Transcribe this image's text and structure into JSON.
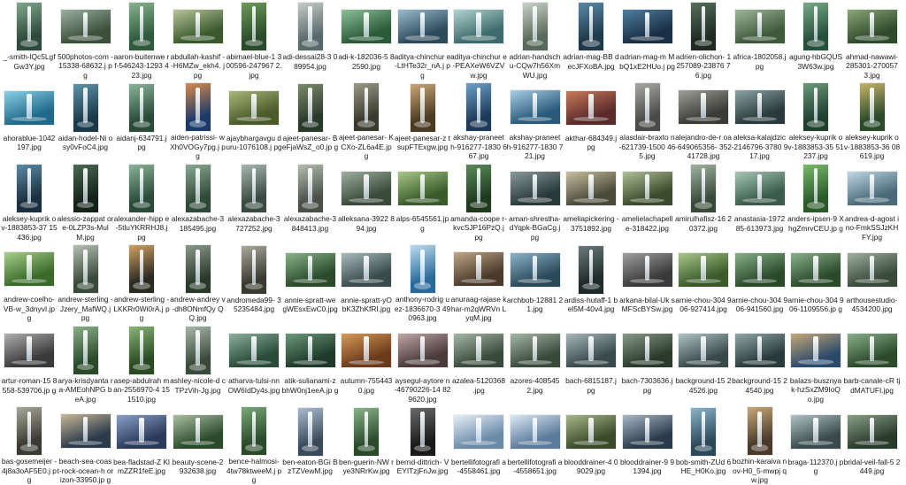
{
  "files": [
    {
      "name": "_-smith-lQc5Lgf Gw3Y.jpg",
      "thumb": "portrait",
      "c": [
        "#2d4a3a",
        "#7fa88c"
      ]
    },
    {
      "name": "500photos-com -15338-68632.j pg",
      "thumb": "landscape",
      "c": [
        "#3b4f3a",
        "#9bb0a0"
      ]
    },
    {
      "name": "aaron-buitenwe rf-546243-1293 423.jpg",
      "thumb": "portrait",
      "c": [
        "#2f5a3c",
        "#88b48f"
      ]
    },
    {
      "name": "abdullah-kashif --H6MZw_ekh4. jpg",
      "thumb": "landscape",
      "c": [
        "#3a5a2c",
        "#b8c49a"
      ]
    },
    {
      "name": "abimael-blue-1 300596-247967 2.jpg",
      "thumb": "portrait",
      "c": [
        "#2b4c2a",
        "#6e9a5a"
      ]
    },
    {
      "name": "adi-dessai28-3 089954.jpg",
      "thumb": "portrait",
      "c": [
        "#5a6a6a",
        "#c4ccc8"
      ]
    },
    {
      "name": "adi-k-182036-5 82590.jpg",
      "thumb": "landscape",
      "c": [
        "#2a5a3a",
        "#8cc09a"
      ]
    },
    {
      "name": "aditya-chinchur e-LtHTe32r_nA.j pg",
      "thumb": "landscape",
      "c": [
        "#2c4a5a",
        "#9bbcd0"
      ]
    },
    {
      "name": "aditya-chinchur e-PEAXeW6VZV w.jpg",
      "thumb": "landscape",
      "c": [
        "#3d6a6a",
        "#b0d4d0"
      ]
    },
    {
      "name": "adrian-handsch u-CQw7h56Xm WU.jpg",
      "thumb": "portrait",
      "c": [
        "#5a6a5a",
        "#c9d2c8"
      ]
    },
    {
      "name": "adrian-mag-BB decJFXoBA.jpg",
      "thumb": "portrait",
      "c": [
        "#1f3a4a",
        "#5a8aa8"
      ]
    },
    {
      "name": "adrian-mag-m MbQ1xE2HUo.j pg",
      "thumb": "landscape",
      "c": [
        "#1a2f45",
        "#4f7fa0"
      ]
    },
    {
      "name": "adrien-olichon- 1257089-23876 76.jpg",
      "thumb": "portrait",
      "c": [
        "#1e2a22",
        "#55705c"
      ]
    },
    {
      "name": "africa-1802058.j pg",
      "thumb": "landscape",
      "c": [
        "#3e5a3a",
        "#9cb898"
      ]
    },
    {
      "name": "agung-hbGQUS 3W63w.jpg",
      "thumb": "portrait",
      "c": [
        "#25503a",
        "#7aaa88"
      ]
    },
    {
      "name": "ahmad-nawawi- 285301-270057 3.jpg",
      "thumb": "landscape",
      "c": [
        "#2e4a2a",
        "#8aa878"
      ]
    },
    {
      "name": "ahorablue-1042 197.jpg",
      "thumb": "landscape",
      "c": [
        "#1f6a8a",
        "#8ad0e8"
      ]
    },
    {
      "name": "aidan-hodel-Ni osy0vFoC4.jpg",
      "thumb": "portrait",
      "c": [
        "#1a3a4a",
        "#5f94a8"
      ]
    },
    {
      "name": "aidanj-634791.j pg",
      "thumb": "portrait",
      "c": [
        "#2a4a3a",
        "#8ab49a"
      ]
    },
    {
      "name": "aiden-patrissi- wXh0VOGy7pg.j pg",
      "thumb": "portrait",
      "c": [
        "#1a3a6a",
        "#d88a4a"
      ]
    },
    {
      "name": "ajaybhargavgu duru-1076108.j pg",
      "thumb": "landscape",
      "c": [
        "#4a5a2a",
        "#a8b878"
      ]
    },
    {
      "name": "ajeet-panesar- BeFjaWsZ_o0.jp g",
      "thumb": "portrait",
      "c": [
        "#2a3a2a",
        "#7a8a6a"
      ]
    },
    {
      "name": "ajeet-panesar- KCXo-ZL6a4E.jp g",
      "thumb": "portrait",
      "c": [
        "#3a3a2e",
        "#9a9a88"
      ]
    },
    {
      "name": "ajeet-panesar-z tsupFTExgw.jpg",
      "thumb": "portrait",
      "c": [
        "#4a3a22",
        "#c8a878"
      ]
    },
    {
      "name": "akshay-praneet h-916277-1830 667.jpg",
      "thumb": "portrait",
      "c": [
        "#1e3a5a",
        "#6aa0c8"
      ]
    },
    {
      "name": "akshay-praneet h-916277-1830 721.jpg",
      "thumb": "landscape",
      "c": [
        "#2a5a7a",
        "#a8d0e8"
      ]
    },
    {
      "name": "akthar-684349.j pg",
      "thumb": "landscape",
      "c": [
        "#5a2a2a",
        "#c87a5a"
      ]
    },
    {
      "name": "alasdair-braxto n-621739-1500 465.jpg",
      "thumb": "portrait",
      "c": [
        "#4a4a48",
        "#a8a8a4"
      ]
    },
    {
      "name": "alejandro-de-r oa-649065356- 35241728.jpg",
      "thumb": "landscape",
      "c": [
        "#3a3a36",
        "#a0a09a"
      ]
    },
    {
      "name": "aleksa-kalajdzic -2146796-3780 917.jpg",
      "thumb": "landscape",
      "c": [
        "#2a3a3a",
        "#8aa4a4"
      ]
    },
    {
      "name": "aleksey-kuprik ov-1883853-35 51237.jpg",
      "thumb": "portrait",
      "c": [
        "#1f3f2f",
        "#6a9a7a"
      ]
    },
    {
      "name": "aleksey-kuprik ov-1883853-36 08619.jpg",
      "thumb": "portrait",
      "c": [
        "#2a4a2a",
        "#c8b46a"
      ]
    },
    {
      "name": "aleksey-kuprik ov-1883853-37 15436.jpg",
      "thumb": "portrait",
      "c": [
        "#1a2f3f",
        "#5a8aa8"
      ]
    },
    {
      "name": "alessio-zappat ore-0LZP3s-Mul M.jpg",
      "thumb": "portrait",
      "c": [
        "#14221a",
        "#4a6a52"
      ]
    },
    {
      "name": "alexander-hipp e-5tluYKRRHJ8.j pg",
      "thumb": "portrait",
      "c": [
        "#2a4a3a",
        "#8ab49a"
      ]
    },
    {
      "name": "alexazabache-3 185495.jpg",
      "thumb": "portrait",
      "c": [
        "#2f4a36",
        "#8aa894"
      ]
    },
    {
      "name": "alexazabache-3 727252.jpg",
      "thumb": "portrait",
      "c": [
        "#3a4a42",
        "#a8b8b0"
      ]
    },
    {
      "name": "alexazabache-3 848413.jpg",
      "thumb": "portrait",
      "c": [
        "#4a5048",
        "#b4bcb0"
      ]
    },
    {
      "name": "alleksana-3922 894.jpg",
      "thumb": "landscape",
      "c": [
        "#3a4a3a",
        "#a0b0a0"
      ]
    },
    {
      "name": "alps-6545561.jp g",
      "thumb": "landscape",
      "c": [
        "#3a5a2a",
        "#a8c888"
      ]
    },
    {
      "name": "amanda-coope r-kvcSJP16PzQ.j pg",
      "thumb": "portrait",
      "c": [
        "#1f3a1f",
        "#5a8a5a"
      ]
    },
    {
      "name": "aman-shrestha- dYqpk-BGaCg.j pg",
      "thumb": "landscape",
      "c": [
        "#2a3a3a",
        "#8a9a9a"
      ]
    },
    {
      "name": "ameliapickering -3751892.jpg",
      "thumb": "landscape",
      "c": [
        "#4a4a3a",
        "#c8c0a0"
      ]
    },
    {
      "name": "amelielachapell e-318422.jpg",
      "thumb": "landscape",
      "c": [
        "#3a4a2a",
        "#b0c098"
      ]
    },
    {
      "name": "amirulhafisz-16 20372.jpg",
      "thumb": "portrait",
      "c": [
        "#3a4a3a",
        "#a0b4a0"
      ]
    },
    {
      "name": "anastasia-1972 85-613973.jpg",
      "thumb": "landscape",
      "c": [
        "#3a5a4a",
        "#a8c8b8"
      ]
    },
    {
      "name": "anders-ipsen-9 XhgZmrvCEU.jp g",
      "thumb": "portrait",
      "c": [
        "#2a5a2a",
        "#7aba6a"
      ]
    },
    {
      "name": "andrea-d-agost ino-FmkSSJzKH FY.jpg",
      "thumb": "landscape",
      "c": [
        "#4a6a7a",
        "#c0dae4"
      ]
    },
    {
      "name": "andrew-coelho- VB-w_3dnyvI.jp g",
      "thumb": "landscape",
      "c": [
        "#3a6a2a",
        "#a8d08a"
      ]
    },
    {
      "name": "andrew-sterling -Jzery_MafWQ.j pg",
      "thumb": "portrait",
      "c": [
        "#3a4a3a",
        "#b4c0b4"
      ]
    },
    {
      "name": "andrew-sterling -LKKRr0Wi0rA.j pg",
      "thumb": "portrait",
      "c": [
        "#2a2a22",
        "#d0a060"
      ]
    },
    {
      "name": "andrew-andrey v-dh8ONmfQy QQ.jpg",
      "thumb": "portrait",
      "c": [
        "#2a3a2a",
        "#8a9a8a"
      ]
    },
    {
      "name": "andromeda99- 35235484.jpg",
      "thumb": "portrait",
      "c": [
        "#3a3a32",
        "#a8a89a"
      ]
    },
    {
      "name": "annie-spratt-we gWEsxEwC0.jpg",
      "thumb": "landscape",
      "c": [
        "#2a4a2a",
        "#8ab48a"
      ]
    },
    {
      "name": "annie-spratt-yO bK3ZhKfRI.jpg",
      "thumb": "landscape",
      "c": [
        "#3a4a4a",
        "#a8bcbc"
      ]
    },
    {
      "name": "anthony-rodrig uez-1836670-3 490963.jpg",
      "thumb": "portrait",
      "c": [
        "#2a6a9a",
        "#bcdcf0"
      ]
    },
    {
      "name": "anuraag-rajase khar-m2qWRVn LyqM.jpg",
      "thumb": "landscape",
      "c": [
        "#4a3a2a",
        "#c0a888"
      ]
    },
    {
      "name": "archbob-12881 21.jpg",
      "thumb": "landscape",
      "c": [
        "#2a4a5a",
        "#8ab4c8"
      ]
    },
    {
      "name": "ardiss-hutaff-1 bel5M-40v4.jpg",
      "thumb": "portrait",
      "c": [
        "#1f2a2a",
        "#6a7a7a"
      ]
    },
    {
      "name": "arkana-bilal-Uk sMFScBYSw.jpg",
      "thumb": "landscape",
      "c": [
        "#3a3a3a",
        "#a0a0a0"
      ]
    },
    {
      "name": "arnie-chou-304 906-927414.jpg",
      "thumb": "landscape",
      "c": [
        "#3a5a2a",
        "#a8c88a"
      ]
    },
    {
      "name": "arnie-chou-304 906-941560.jpg",
      "thumb": "landscape",
      "c": [
        "#2a4a2a",
        "#88b088"
      ]
    },
    {
      "name": "arnie-chou-304 906-1109556.jp g",
      "thumb": "landscape",
      "c": [
        "#2a4a2a",
        "#8ab08a"
      ]
    },
    {
      "name": "arthousestudio- 4534200.jpg",
      "thumb": "landscape",
      "c": [
        "#3a4a3a",
        "#a0b0a0"
      ]
    },
    {
      "name": "artur-roman-15 8558-539706.jp g",
      "thumb": "landscape",
      "c": [
        "#3a3a3a",
        "#b0b0b0"
      ]
    },
    {
      "name": "arya-krisdyanta ra-AMEohNPG beA.jpg",
      "thumb": "portrait",
      "c": [
        "#2a4a2a",
        "#8ab08a"
      ]
    },
    {
      "name": "asep-abdulrah man-2556970-4 151510.jpg",
      "thumb": "portrait",
      "c": [
        "#2a4a22",
        "#8ab478"
      ]
    },
    {
      "name": "ashley-nicole-d cTPzVih-Jg.jpg",
      "thumb": "portrait",
      "c": [
        "#3a4a3a",
        "#a8b8a8"
      ]
    },
    {
      "name": "atharva-tulsi-nn OW6IdDy4s.jpg",
      "thumb": "landscape",
      "c": [
        "#2a4a3a",
        "#8ab09a"
      ]
    },
    {
      "name": "atik-sulianami-z bhW0nj1eeA.jp g",
      "thumb": "landscape",
      "c": [
        "#1f3a2a",
        "#6a9a7a"
      ]
    },
    {
      "name": "autumn-755443 0.jpg",
      "thumb": "landscape",
      "c": [
        "#6a3a1a",
        "#d89a5a"
      ]
    },
    {
      "name": "aysegul-aytore n-46790226-14 829620.jpg",
      "thumb": "landscape",
      "c": [
        "#4a3a3a",
        "#c0a8a8"
      ]
    },
    {
      "name": "azalea-5120368 .jpg",
      "thumb": "landscape",
      "c": [
        "#3a4a3a",
        "#a8b8a8"
      ]
    },
    {
      "name": "azores-408545 2.jpg",
      "thumb": "landscape",
      "c": [
        "#3a4a3a",
        "#a8b8a8"
      ]
    },
    {
      "name": "bach-6815187.j pg",
      "thumb": "landscape",
      "c": [
        "#3a4a4a",
        "#a8b8b8"
      ]
    },
    {
      "name": "bach-7303636.j pg",
      "thumb": "landscape",
      "c": [
        "#2a3a2a",
        "#8a9a8a"
      ]
    },
    {
      "name": "background-15 24526.jpg",
      "thumb": "landscape",
      "c": [
        "#3a4a4a",
        "#b0c4c4"
      ]
    },
    {
      "name": "background-15 24540.jpg",
      "thumb": "landscape",
      "c": [
        "#2a3a3a",
        "#90a8a8"
      ]
    },
    {
      "name": "balazs-busznya k-hzSxZM9IoQ o.jpg",
      "thumb": "landscape",
      "c": [
        "#2a4a6a",
        "#c8a878"
      ]
    },
    {
      "name": "barb-canale-cR tjdMATUFI.jpg",
      "thumb": "landscape",
      "c": [
        "#2a4a2a",
        "#8ab08a"
      ]
    },
    {
      "name": "bas-gosemeijer -4j8a3oAF5E0.j pg",
      "thumb": "portrait",
      "c": [
        "#3a3a32",
        "#a8a89a"
      ]
    },
    {
      "name": "beach-sea-coas t-rock-ocean-h orizon-33950.jp g",
      "thumb": "landscape",
      "c": [
        "#2a3a4a",
        "#c8b898"
      ]
    },
    {
      "name": "bea-fladstad-Z KlmZZR1feE.jpg",
      "thumb": "landscape",
      "c": [
        "#2a3a5a",
        "#8aa0c8"
      ]
    },
    {
      "name": "beauty-scene-2 932638.jpg",
      "thumb": "landscape",
      "c": [
        "#2a4a2a",
        "#a8c0a0"
      ]
    },
    {
      "name": "bence-halmosi- 4tw78ktweeM.j pg",
      "thumb": "portrait",
      "c": [
        "#2a4a2a",
        "#7aa87a"
      ]
    },
    {
      "name": "ben-eaton-BGi BzTZVewM.jpg",
      "thumb": "portrait",
      "c": [
        "#3a4a5a",
        "#a8bcd0"
      ]
    },
    {
      "name": "ben-guerin-NW rye3NRrKw.jpg",
      "thumb": "portrait",
      "c": [
        "#2a4a2a",
        "#8ab48a"
      ]
    },
    {
      "name": "bernd-dittrich- VEYITzjFnJw.jpg",
      "thumb": "portrait",
      "c": [
        "#1a1a1a",
        "#6a6a6a"
      ]
    },
    {
      "name": "bertellifotografi a-4558461.jpg",
      "thumb": "landscape",
      "c": [
        "#6a8aa8",
        "#e8f0f8"
      ]
    },
    {
      "name": "bertellifotografi a-4558651.jpg",
      "thumb": "landscape",
      "c": [
        "#5a7a9a",
        "#dce8f4"
      ]
    },
    {
      "name": "blooddrainer-4 09029.jpg",
      "thumb": "landscape",
      "c": [
        "#3a4a2a",
        "#a8b888"
      ]
    },
    {
      "name": "blooddrainer-9 91394.jpg",
      "thumb": "landscape",
      "c": [
        "#2a3a4a",
        "#a8b8c8"
      ]
    },
    {
      "name": "bob-smith-ZUd 6HE_H0Ko.jpg",
      "thumb": "portrait",
      "c": [
        "#2a4a5a",
        "#8ab4c8"
      ]
    },
    {
      "name": "bozhin-karaiva nov-H0_5-mwpj qw.jpg",
      "thumb": "portrait",
      "c": [
        "#4a3a2a",
        "#c8a878"
      ]
    },
    {
      "name": "braga-112370.j pg",
      "thumb": "landscape",
      "c": [
        "#3a4a4a",
        "#b0c4c4"
      ]
    },
    {
      "name": "bridal-veil-fall-5 2449.jpg",
      "thumb": "landscape",
      "c": [
        "#2a3a2a",
        "#8aa08a"
      ]
    }
  ]
}
